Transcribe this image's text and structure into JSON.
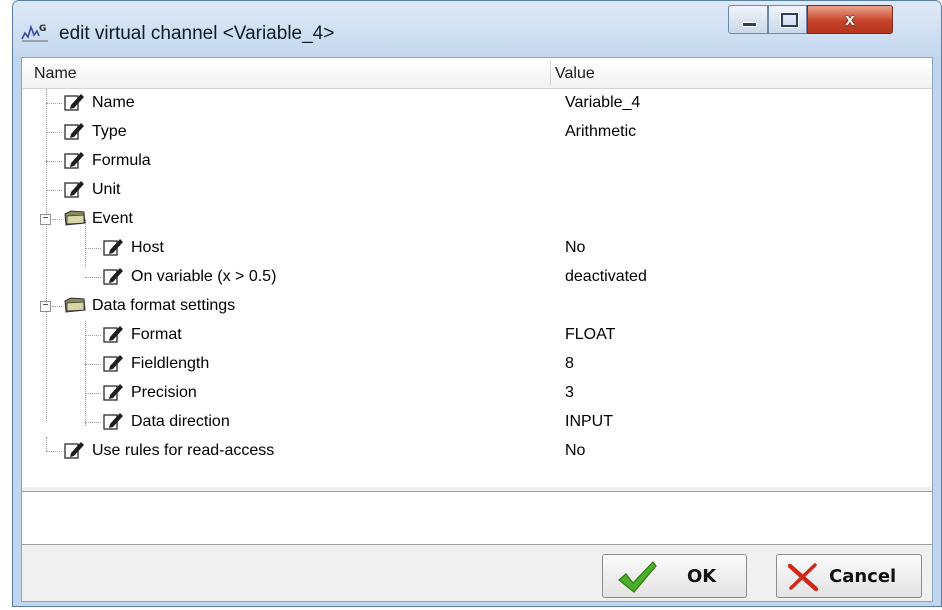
{
  "window": {
    "title": "edit virtual channel <Variable_4>"
  },
  "columns": {
    "name": "Name",
    "value": "Value"
  },
  "rows": [
    {
      "label": "Name",
      "value": "Variable_4",
      "kind": "property"
    },
    {
      "label": "Type",
      "value": "Arithmetic",
      "kind": "property"
    },
    {
      "label": "Formula",
      "value": "",
      "kind": "property"
    },
    {
      "label": "Unit",
      "value": "",
      "kind": "property"
    },
    {
      "label": "Event",
      "value": "",
      "kind": "group",
      "expanded": true
    },
    {
      "label": "Host",
      "value": "No",
      "kind": "property"
    },
    {
      "label": "On variable (x > 0.5)",
      "value": "deactivated",
      "kind": "property"
    },
    {
      "label": "Data format settings",
      "value": "",
      "kind": "group",
      "expanded": true
    },
    {
      "label": "Format",
      "value": "FLOAT",
      "kind": "property"
    },
    {
      "label": "Fieldlength",
      "value": "8",
      "kind": "property"
    },
    {
      "label": "Precision",
      "value": "3",
      "kind": "property"
    },
    {
      "label": "Data direction",
      "value": "INPUT",
      "kind": "property"
    },
    {
      "label": "Use rules for read-access",
      "value": "No",
      "kind": "property"
    }
  ],
  "buttons": {
    "ok": "OK",
    "cancel": "Cancel"
  },
  "controls": {
    "close_glyph": "x"
  },
  "icons": {
    "property": "edit-pencil-icon",
    "group": "folder-icon",
    "ok": "checkmark-icon",
    "cancel": "cross-icon"
  }
}
